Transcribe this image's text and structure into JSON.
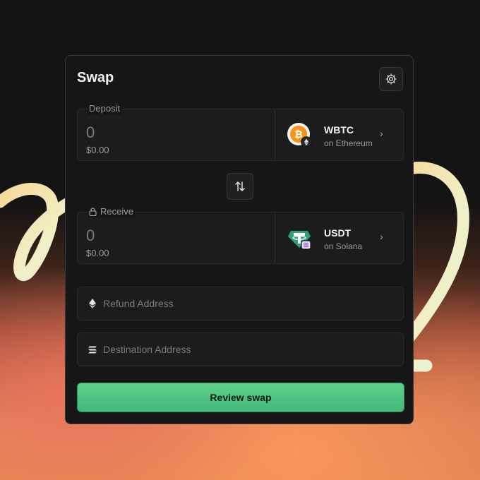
{
  "swap": {
    "title": "Swap",
    "settings_icon": "gear-icon",
    "deposit": {
      "label": "Deposit",
      "amount": "0",
      "usd_value": "$0.00",
      "token_symbol": "WBTC",
      "token_chain": "on Ethereum",
      "chevron": "›"
    },
    "flip_icon": "swap-vertical-arrows-icon",
    "receive": {
      "label": "Receive",
      "lock_icon": "lock-icon",
      "amount": "0",
      "usd_value": "$0.00",
      "token_symbol": "USDT",
      "token_chain": "on Solana",
      "chevron": "›"
    },
    "refund_address": {
      "placeholder": "Refund Address",
      "value": "",
      "icon": "ethereum-icon"
    },
    "destination_address": {
      "placeholder": "Destination Address",
      "value": "",
      "icon": "solana-icon"
    },
    "review_button": "Review swap"
  },
  "colors": {
    "panel_bg": "#161616",
    "field_bg": "#1c1c1c",
    "accent_green": "#4fc282",
    "bitcoin_orange": "#f7931a",
    "tether_green": "#2f9e7e",
    "solana_purple": "#9945ff"
  }
}
